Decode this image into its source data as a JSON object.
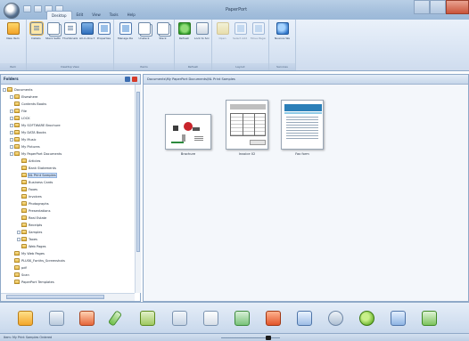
{
  "app": {
    "title": "PaperPort"
  },
  "window_controls": [
    "minimize",
    "maximize",
    "close"
  ],
  "quick_access": [
    "save-icon",
    "undo-icon",
    "redo-icon",
    "dropdown-icon"
  ],
  "tabs": [
    {
      "label": "Desktop",
      "active": true
    },
    {
      "label": "Edit",
      "active": false
    },
    {
      "label": "View",
      "active": false
    },
    {
      "label": "Tools",
      "active": false
    },
    {
      "label": "Help",
      "active": false
    }
  ],
  "ribbon": {
    "groups": [
      {
        "label": "Item",
        "buttons": [
          {
            "label": "New Item",
            "icon": "new-document-icon"
          }
        ]
      },
      {
        "label": "Desktop View",
        "buttons": [
          {
            "label": "Details",
            "icon": "thumbnail-view-icon",
            "selected": true
          },
          {
            "label": "Stack Settings",
            "icon": "stack-icon"
          },
          {
            "label": "Thumbnails",
            "icon": "thumbnails-icon"
          },
          {
            "label": "All-in-One Search",
            "icon": "search-icon"
          },
          {
            "label": "Properties",
            "icon": "properties-icon"
          }
        ]
      },
      {
        "label": "Items",
        "buttons": [
          {
            "label": "Manage Desktop Items",
            "icon": "manage-icon"
          },
          {
            "label": "Unstack",
            "icon": "unstack-icon"
          },
          {
            "label": "Stack",
            "icon": "stack-pages-icon"
          }
        ]
      },
      {
        "label": "Refresh",
        "buttons": [
          {
            "label": "Refresh",
            "icon": "refresh-icon"
          },
          {
            "label": "Lock to Screen",
            "icon": "lock-icon"
          }
        ]
      },
      {
        "label": "Layout",
        "buttons": [
          {
            "label": "Open",
            "icon": "open-icon",
            "dim": true
          },
          {
            "label": "Select Add Pages",
            "icon": "add-pages-icon",
            "dim": true
          },
          {
            "label": "Move Pages",
            "icon": "move-pages-icon",
            "dim": true
          }
        ]
      },
      {
        "label": "Services",
        "buttons": [
          {
            "label": "Nuance Website",
            "icon": "globe-icon"
          }
        ]
      }
    ]
  },
  "folders": {
    "header": "Folders",
    "items": [
      {
        "label": "Documents",
        "indent": 0,
        "expander": "minus"
      },
      {
        "label": "Elsewhere",
        "indent": 1,
        "expander": "plus"
      },
      {
        "label": "Contents Books",
        "indent": 1,
        "expander": "none"
      },
      {
        "label": "File",
        "indent": 1,
        "expander": "plus"
      },
      {
        "label": "LOCK",
        "indent": 1,
        "expander": "plus"
      },
      {
        "label": "My SOFTWARE Brochure",
        "indent": 1,
        "expander": "plus"
      },
      {
        "label": "My DATA Books",
        "indent": 1,
        "expander": "plus"
      },
      {
        "label": "My Music",
        "indent": 1,
        "expander": "plus"
      },
      {
        "label": "My Pictures",
        "indent": 1,
        "expander": "plus"
      },
      {
        "label": "My PaperPort Documents",
        "indent": 1,
        "expander": "minus"
      },
      {
        "label": "Articles",
        "indent": 2,
        "expander": "none"
      },
      {
        "label": "Bank Statements",
        "indent": 2,
        "expander": "none"
      },
      {
        "label": "NL Print Samples",
        "indent": 2,
        "expander": "none",
        "selected": true
      },
      {
        "label": "Business Cards",
        "indent": 2,
        "expander": "none"
      },
      {
        "label": "Faxes",
        "indent": 2,
        "expander": "none"
      },
      {
        "label": "Invoices",
        "indent": 2,
        "expander": "none"
      },
      {
        "label": "Photographs",
        "indent": 2,
        "expander": "none"
      },
      {
        "label": "Presentations",
        "indent": 2,
        "expander": "none"
      },
      {
        "label": "Real Estate",
        "indent": 2,
        "expander": "none"
      },
      {
        "label": "Receipts",
        "indent": 2,
        "expander": "none"
      },
      {
        "label": "Samples",
        "indent": 2,
        "expander": "plus"
      },
      {
        "label": "Taxes",
        "indent": 2,
        "expander": "plus"
      },
      {
        "label": "Web Pages",
        "indent": 2,
        "expander": "none"
      },
      {
        "label": "My Web Pages",
        "indent": 1,
        "expander": "none"
      },
      {
        "label": "PLUSK_Fonths_Screenshots",
        "indent": 1,
        "expander": "none"
      },
      {
        "label": "pdf",
        "indent": 1,
        "expander": "none"
      },
      {
        "label": "Scan",
        "indent": 1,
        "expander": "none"
      },
      {
        "label": "PaperPort Templates",
        "indent": 1,
        "expander": "none"
      }
    ]
  },
  "content": {
    "path": "Documents\\My PaperPort Documents\\NL Print Samples",
    "items": [
      {
        "name": "Brochure",
        "kind": "brochure"
      },
      {
        "name": "Invoice 02",
        "kind": "invoice"
      },
      {
        "name": "Fax form",
        "kind": "fax"
      }
    ]
  },
  "bottombar": {
    "icons": [
      "scanner-icon",
      "printer-icon",
      "acrobat-icon",
      "pen-icon",
      "excel-icon",
      "word-icon",
      "notepad-icon",
      "image-editor-icon",
      "office-icon",
      "paint-icon",
      "tools-icon",
      "green-app-icon",
      "chart-icon",
      "ocr-icon"
    ]
  },
  "statusbar": {
    "text": "Item: My Print Samples Ordered",
    "zoom_level": 0.8
  }
}
